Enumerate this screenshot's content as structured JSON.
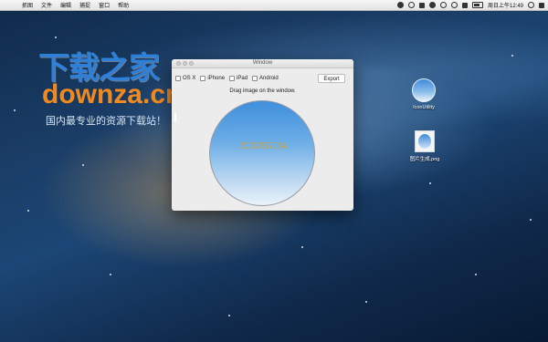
{
  "menubar": {
    "apple": "",
    "items": [
      "抓图",
      "文件",
      "编辑",
      "捕捉",
      "窗口",
      "帮助"
    ],
    "clock": "周日上午12:49"
  },
  "watermark": {
    "title_cn": "下载之家",
    "title_en": "downza.cn",
    "subtitle": "国内最专业的资源下载站！"
  },
  "window": {
    "title": "Window",
    "options": [
      "OS X",
      "iPhone",
      "iPad",
      "Android"
    ],
    "export_label": "Export",
    "hint": "Drag image on the window.",
    "drop_text": "ICONSTUA"
  },
  "desktop_icons": [
    {
      "label": "IconUtility"
    },
    {
      "label": "图片生成.png"
    }
  ],
  "colors": {
    "brand_blue": "#2d7fd8",
    "brand_orange": "#f08a1e",
    "drop_top": "#3f8fdc"
  }
}
